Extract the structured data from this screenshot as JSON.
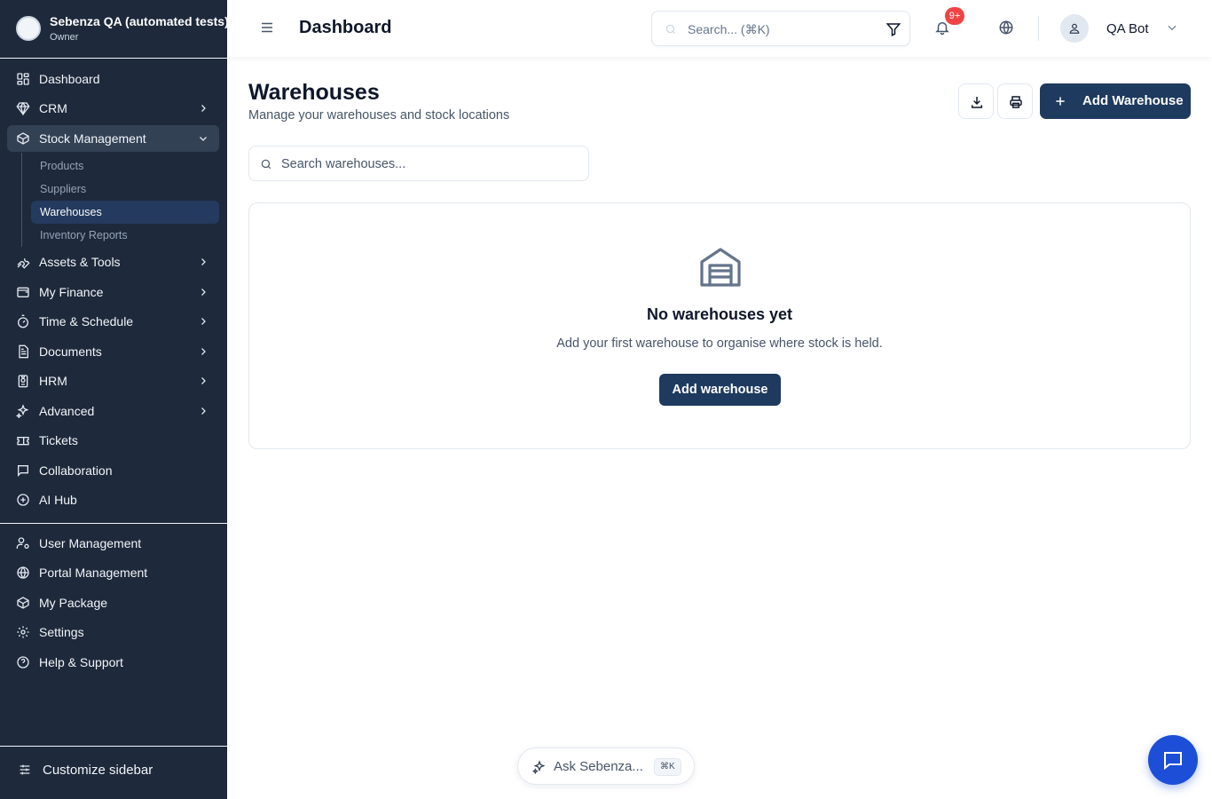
{
  "org": {
    "name": "Sebenza QA (automated tests)",
    "role": "Owner"
  },
  "sidebar": {
    "items": [
      {
        "label": "Dashboard",
        "icon": "dashboard-icon"
      },
      {
        "label": "CRM",
        "icon": "gem-icon"
      },
      {
        "label": "Stock Management",
        "icon": "box-icon",
        "expanded": true
      },
      {
        "label": "Assets & Tools",
        "icon": "wrench-icon"
      },
      {
        "label": "My Finance",
        "icon": "wallet-icon"
      },
      {
        "label": "Time & Schedule",
        "icon": "timer-icon"
      },
      {
        "label": "Documents",
        "icon": "document-icon"
      },
      {
        "label": "HRM",
        "icon": "id-badge-icon"
      },
      {
        "label": "Advanced",
        "icon": "sparkles-icon"
      },
      {
        "label": "Tickets",
        "icon": "ticket-icon"
      },
      {
        "label": "Collaboration",
        "icon": "message-icon"
      },
      {
        "label": "AI Hub",
        "icon": "bot-icon"
      }
    ],
    "stock_sub": [
      "Products",
      "Suppliers",
      "Warehouses",
      "Inventory Reports"
    ],
    "active_sub": "Warehouses",
    "bottom_items": [
      {
        "label": "User Management",
        "icon": "user-cog-icon"
      },
      {
        "label": "Portal Management",
        "icon": "globe-icon"
      },
      {
        "label": "My Package",
        "icon": "package-icon"
      },
      {
        "label": "Settings",
        "icon": "gear-icon"
      },
      {
        "label": "Help & Support",
        "icon": "help-icon"
      }
    ],
    "customize_label": "Customize sidebar"
  },
  "topbar": {
    "title": "Dashboard",
    "search_placeholder": "Search... (⌘K)",
    "notifications_badge": "9+",
    "user_name": "QA Bot"
  },
  "main": {
    "title": "Warehouses",
    "subtitle": "Manage your warehouses and stock locations",
    "add_button": "Add Warehouse",
    "search_placeholder": "Search warehouses...",
    "empty": {
      "title": "No warehouses yet",
      "subtitle": "Add your first warehouse to organise where stock is held.",
      "button": "Add warehouse"
    }
  },
  "ask": {
    "label": "Ask Sebenza...",
    "shortcut": "⌘K"
  },
  "colors": {
    "sidebar_bg": "#1e293b",
    "primary": "#1e3a5f",
    "fab": "#1d4ed8",
    "badge": "#ef4444"
  }
}
